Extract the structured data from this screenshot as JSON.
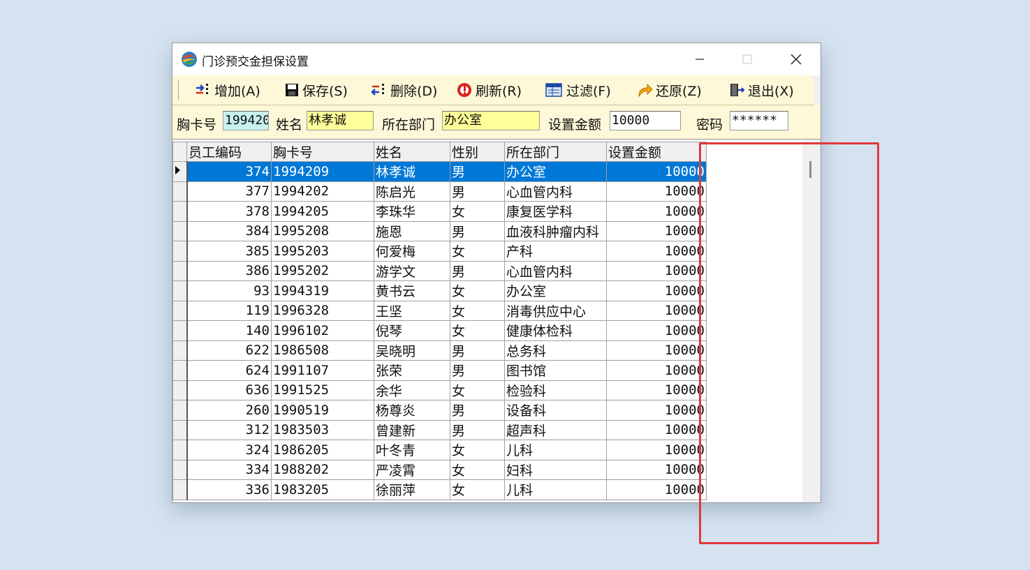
{
  "window": {
    "title": "门诊预交金担保设置",
    "controls": {
      "minimize": "—",
      "maximize": "☐",
      "close": "✕"
    }
  },
  "toolbar": {
    "add": "增加(A)",
    "save": "保存(S)",
    "delete": "删除(D)",
    "refresh": "刷新(R)",
    "filter": "过滤(F)",
    "restore": "还原(Z)",
    "exit": "退出(X)"
  },
  "form": {
    "card_label": "胸卡号",
    "card_value": "199420",
    "name_label": "姓名",
    "name_value": "林孝诚",
    "dept_label": "所在部门",
    "dept_value": "办公室",
    "amount_label": "设置金额",
    "amount_value": "10000",
    "password_label": "密码",
    "password_value": "******"
  },
  "grid": {
    "columns": [
      "员工编码",
      "胸卡号",
      "姓名",
      "性别",
      "所在部门",
      "设置金额"
    ],
    "rows": [
      [
        "374",
        "1994209",
        "林孝诚",
        "男",
        "办公室",
        "10000"
      ],
      [
        "377",
        "1994202",
        "陈启光",
        "男",
        "心血管内科",
        "10000"
      ],
      [
        "378",
        "1994205",
        "李珠华",
        "女",
        "康复医学科",
        "10000"
      ],
      [
        "384",
        "1995208",
        "施恩",
        "男",
        "血液科肿瘤内科",
        "10000"
      ],
      [
        "385",
        "1995203",
        "何爱梅",
        "女",
        "产科",
        "10000"
      ],
      [
        "386",
        "1995202",
        "游学文",
        "男",
        "心血管内科",
        "10000"
      ],
      [
        "93",
        "1994319",
        "黄书云",
        "女",
        "办公室",
        "10000"
      ],
      [
        "119",
        "1996328",
        "王坚",
        "女",
        "消毒供应中心",
        "10000"
      ],
      [
        "140",
        "1996102",
        "倪琴",
        "女",
        "健康体检科",
        "10000"
      ],
      [
        "622",
        "1986508",
        "吴晓明",
        "男",
        "总务科",
        "10000"
      ],
      [
        "624",
        "1991107",
        "张荣",
        "男",
        "图书馆",
        "10000"
      ],
      [
        "636",
        "1991525",
        "余华",
        "女",
        "检验科",
        "10000"
      ],
      [
        "260",
        "1990519",
        "杨尊炎",
        "男",
        "设备科",
        "10000"
      ],
      [
        "312",
        "1983503",
        "曾建新",
        "男",
        "超声科",
        "10000"
      ],
      [
        "324",
        "1986205",
        "叶冬青",
        "女",
        "儿科",
        "10000"
      ],
      [
        "334",
        "1988202",
        "严凌霄",
        "女",
        "妇科",
        "10000"
      ],
      [
        "336",
        "1983205",
        "徐丽萍",
        "女",
        "儿科",
        "10000"
      ]
    ],
    "selected_row": 0
  },
  "colors": {
    "toolbar_bg": "#fdf8d8",
    "selection": "#0078d7",
    "highlight": "#e0393c",
    "input_yellow": "#ffff99",
    "input_cyan": "#c8f0f0"
  }
}
